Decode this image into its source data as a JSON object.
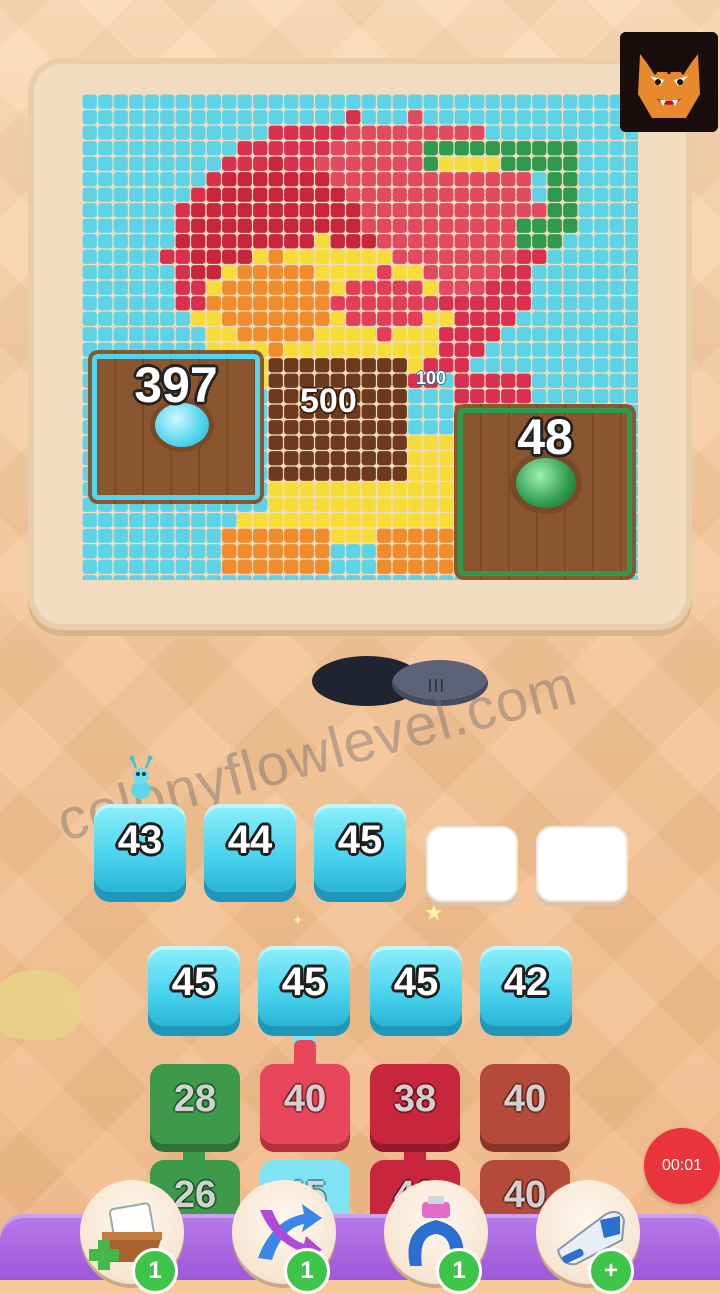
{
  "board": {
    "chests": [
      {
        "name": "cyan-chest",
        "count": "397",
        "color": "#4fd6ee"
      },
      {
        "name": "green-chest",
        "count": "48",
        "color": "#2f9a4d"
      }
    ],
    "chocolate_count": "500",
    "small_count": "100"
  },
  "slots": [
    {
      "label": "43",
      "filled": true
    },
    {
      "label": "44",
      "filled": true
    },
    {
      "label": "45",
      "filled": true
    },
    {
      "label": "",
      "filled": false
    },
    {
      "label": "",
      "filled": false
    }
  ],
  "queue_top": [
    "45",
    "45",
    "45",
    "42"
  ],
  "tubes_row1": [
    {
      "label": "28",
      "color": "#3e9a4b"
    },
    {
      "label": "40",
      "color": "#e8465a"
    },
    {
      "label": "38",
      "color": "#c8263d"
    },
    {
      "label": "40",
      "color": "#b44a3a"
    }
  ],
  "tubes_row2": [
    {
      "label": "26",
      "color": "#3e9a4b"
    },
    {
      "label": "45",
      "color": "#7fe3f4"
    },
    {
      "label": "40",
      "color": "#c8263d"
    },
    {
      "label": "40",
      "color": "#b44a3a"
    }
  ],
  "timer": "00:01",
  "watermark": "colonyflowlevel.com",
  "tools": [
    {
      "name": "shuffle-box-tool",
      "badge": "1"
    },
    {
      "name": "arrow-swap-tool",
      "badge": "1"
    },
    {
      "name": "magnet-tool",
      "badge": "1"
    },
    {
      "name": "vacuum-tool",
      "badge": "+"
    }
  ],
  "colors": {
    "accent_cyan": "#49d3ee",
    "toolbar_purple": "#b97ae8",
    "timer_red": "#e8343a"
  }
}
